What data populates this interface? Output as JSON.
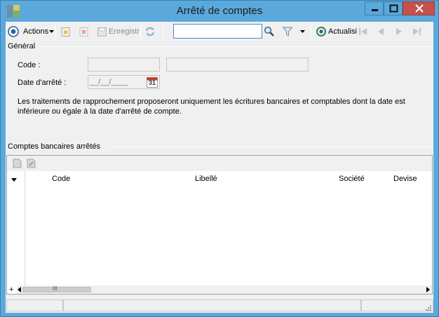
{
  "window": {
    "title": "Arrêté de comptes"
  },
  "toolbar": {
    "actions_label": "Actions",
    "save_label": "Enregistr",
    "refresh_label": "Actualisi",
    "search_value": "",
    "search_placeholder": ""
  },
  "general": {
    "group_label": "Général",
    "code_label": "Code :",
    "code_value": "",
    "code_description": "",
    "date_label": "Date d'arrêté :",
    "date_value": "__/__/____",
    "calendar_day": "31",
    "info_text": "Les traitements de rapprochement proposeront uniquement les écritures bancaires et comptables dont la date est inférieure ou égale à la date d'arrêté de compte."
  },
  "accounts": {
    "group_label": "Comptes bancaires arrêtés",
    "columns": [
      "Code",
      "Libellé",
      "Société",
      "Devise"
    ],
    "rows": [],
    "add_row_glyph": "+",
    "scroll_thumb_glyph": "III"
  },
  "colors": {
    "accent": "#5ba8dc",
    "close": "#c7504c",
    "calendar": "#c0392b"
  },
  "icons": {
    "app": "app-icon",
    "actions": "circle-target-icon",
    "new": "new-document-icon",
    "delete": "delete-icon",
    "save": "save-icon",
    "refresh": "refresh-icon",
    "search": "magnifier-icon",
    "filter": "funnel-icon",
    "first": "first-record-icon",
    "prev": "previous-record-icon",
    "next": "next-record-icon",
    "last": "last-record-icon"
  }
}
